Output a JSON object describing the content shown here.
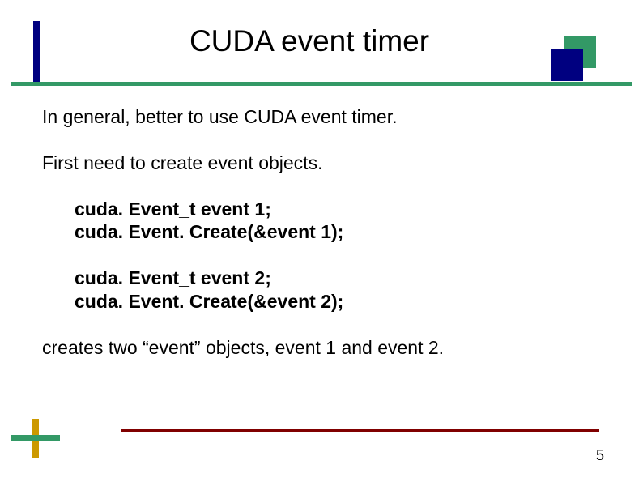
{
  "title": "CUDA event timer",
  "body": {
    "intro1": "In general, better to use CUDA event timer.",
    "intro2": "First need to create event objects.",
    "code1": {
      "line1": "cuda. Event_t event 1;",
      "line2": "cuda. Event. Create(&event 1);"
    },
    "code2": {
      "line1": "cuda. Event_t event 2;",
      "line2": "cuda. Event. Create(&event 2);"
    },
    "outro": "creates two “event” objects, event 1 and event 2."
  },
  "pageNumber": "5"
}
